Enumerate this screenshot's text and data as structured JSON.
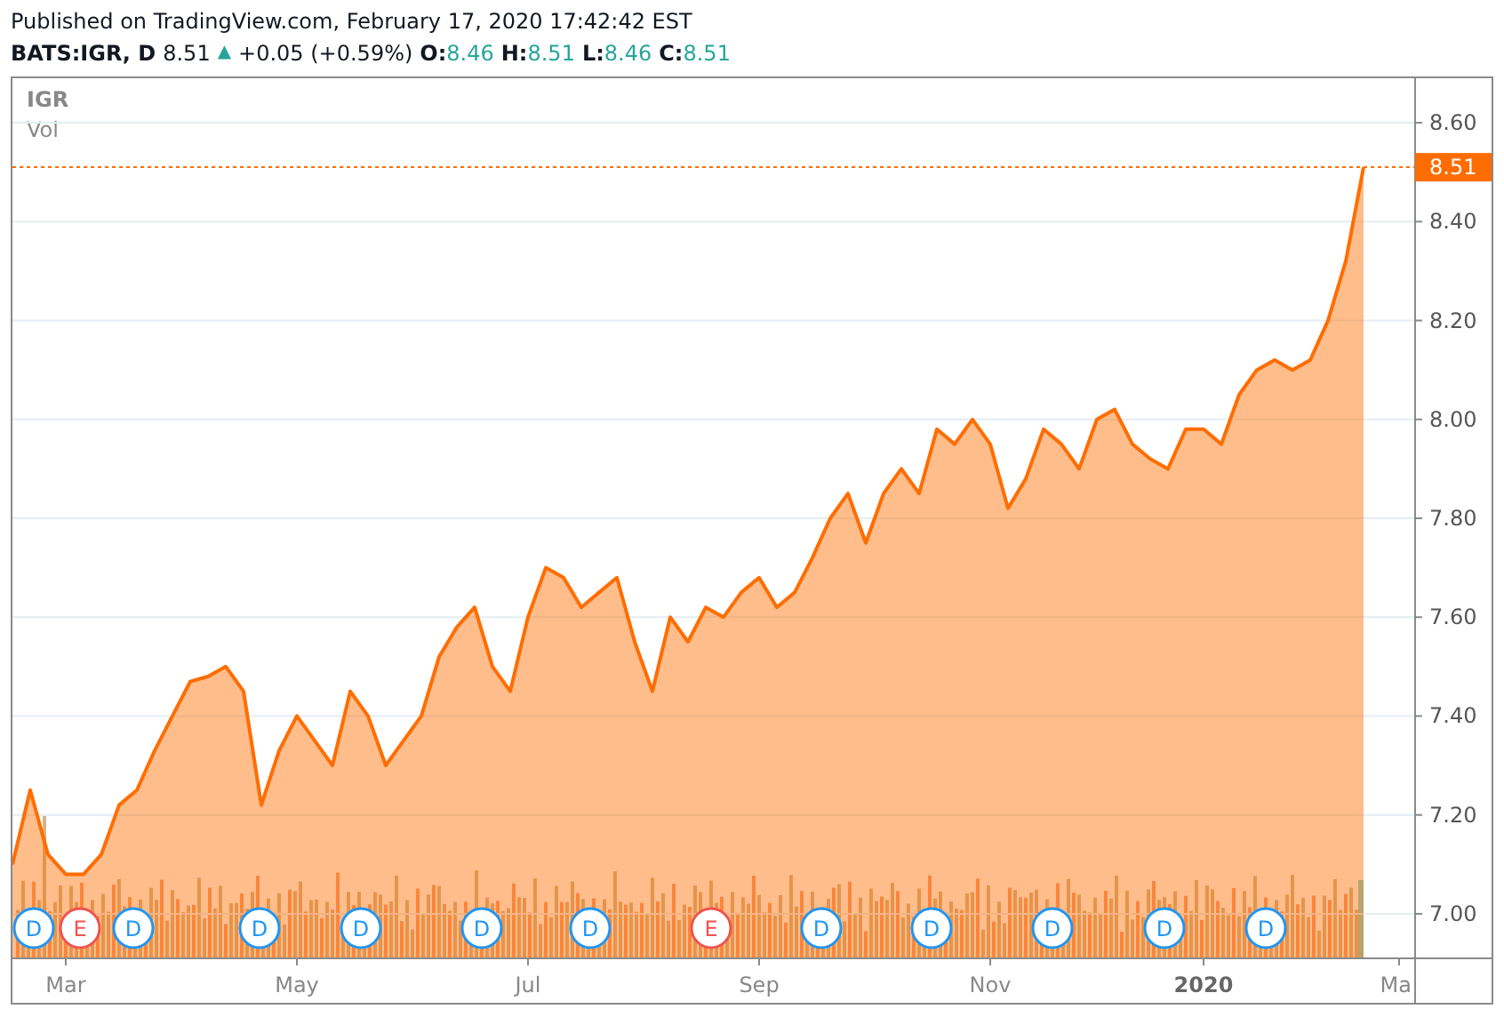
{
  "header": {
    "published": "Published on TradingView.com, February 17, 2020 17:42:42 EST",
    "symbol": "BATS:IGR, D",
    "price": "8.51",
    "change_icon": "▲",
    "change": "+0.05 (+0.59%)",
    "ohlc": [
      {
        "label": "O:",
        "value": "8.46"
      },
      {
        "label": "H:",
        "value": "8.51"
      },
      {
        "label": "L:",
        "value": "8.46"
      },
      {
        "label": "C:",
        "value": "8.51"
      }
    ]
  },
  "legend": {
    "volume": "Vol"
  },
  "chart": {
    "chart_data": {
      "type": "area",
      "grid": true,
      "categories": [
        null,
        null,
        null,
        "Mar",
        null,
        null,
        null,
        null,
        null,
        null,
        null,
        null,
        null,
        null,
        null,
        null,
        "May",
        null,
        null,
        null,
        null,
        null,
        null,
        null,
        null,
        null,
        null,
        null,
        null,
        "Jul",
        null,
        null,
        null,
        null,
        null,
        null,
        null,
        null,
        null,
        null,
        null,
        null,
        "Sep",
        null,
        null,
        null,
        null,
        null,
        null,
        null,
        null,
        null,
        null,
        null,
        null,
        "Nov",
        null,
        null,
        null,
        null,
        null,
        null,
        null,
        null,
        null,
        null,
        null,
        "2020",
        null,
        null,
        null,
        null,
        null,
        null,
        null,
        null,
        null,
        null,
        "Ma"
      ],
      "series": [
        {
          "name": "IGR",
          "color": "#ff6d00",
          "values": [
            7.1,
            7.25,
            7.12,
            7.08,
            7.08,
            7.12,
            7.22,
            7.25,
            7.33,
            7.4,
            7.47,
            7.48,
            7.5,
            7.45,
            7.22,
            7.33,
            7.4,
            7.35,
            7.3,
            7.45,
            7.4,
            7.3,
            7.35,
            7.4,
            7.52,
            7.58,
            7.62,
            7.5,
            7.45,
            7.6,
            7.7,
            7.68,
            7.62,
            7.65,
            7.68,
            7.55,
            7.45,
            7.6,
            7.55,
            7.62,
            7.6,
            7.65,
            7.68,
            7.62,
            7.65,
            7.72,
            7.8,
            7.85,
            7.75,
            7.85,
            7.9,
            7.85,
            7.98,
            7.95,
            8.0,
            7.95,
            7.82,
            7.88,
            7.98,
            7.95,
            7.9,
            8.0,
            8.02,
            7.95,
            7.92,
            7.9,
            7.98,
            7.98,
            7.95,
            8.05,
            8.1,
            8.12,
            8.1,
            8.12,
            8.2,
            8.32,
            8.51,
            null,
            null
          ]
        }
      ],
      "ylim": [
        6.91,
        8.69
      ],
      "yticks": [
        {
          "value": 7.0,
          "label": "7.00"
        },
        {
          "value": 7.2,
          "label": "7.20"
        },
        {
          "value": 7.4,
          "label": "7.40"
        },
        {
          "value": 7.6,
          "label": "7.60"
        },
        {
          "value": 7.8,
          "label": "7.80"
        },
        {
          "value": 8.0,
          "label": "8.00"
        },
        {
          "value": 8.2,
          "label": "8.20"
        },
        {
          "value": 8.4,
          "label": "8.40"
        },
        {
          "value": 8.6,
          "label": "8.60"
        }
      ],
      "ref_lines": [
        {
          "axis": "y",
          "value": 8.51,
          "label": "8.51",
          "color": "#ff6d00"
        }
      ]
    },
    "event_markers": [
      {
        "text": "D",
        "kind": "dividend"
      },
      {
        "text": "E",
        "kind": "earnings"
      },
      {
        "text": "D",
        "kind": "dividend"
      },
      {
        "text": "D",
        "kind": "dividend"
      },
      {
        "text": "D",
        "kind": "dividend"
      },
      {
        "text": "D",
        "kind": "dividend"
      },
      {
        "text": "D",
        "kind": "dividend"
      },
      {
        "text": "E",
        "kind": "earnings"
      },
      {
        "text": "D",
        "kind": "dividend"
      },
      {
        "text": "D",
        "kind": "dividend"
      },
      {
        "text": "D",
        "kind": "dividend"
      },
      {
        "text": "D",
        "kind": "dividend"
      },
      {
        "text": "D",
        "kind": "dividend"
      }
    ],
    "time_axis_labels": [
      {
        "kind": "month"
      },
      {
        "kind": "month"
      },
      {
        "kind": "month"
      },
      {
        "kind": "month"
      },
      {
        "kind": "month"
      },
      {
        "kind": "year"
      },
      {
        "kind": "month"
      }
    ]
  }
}
